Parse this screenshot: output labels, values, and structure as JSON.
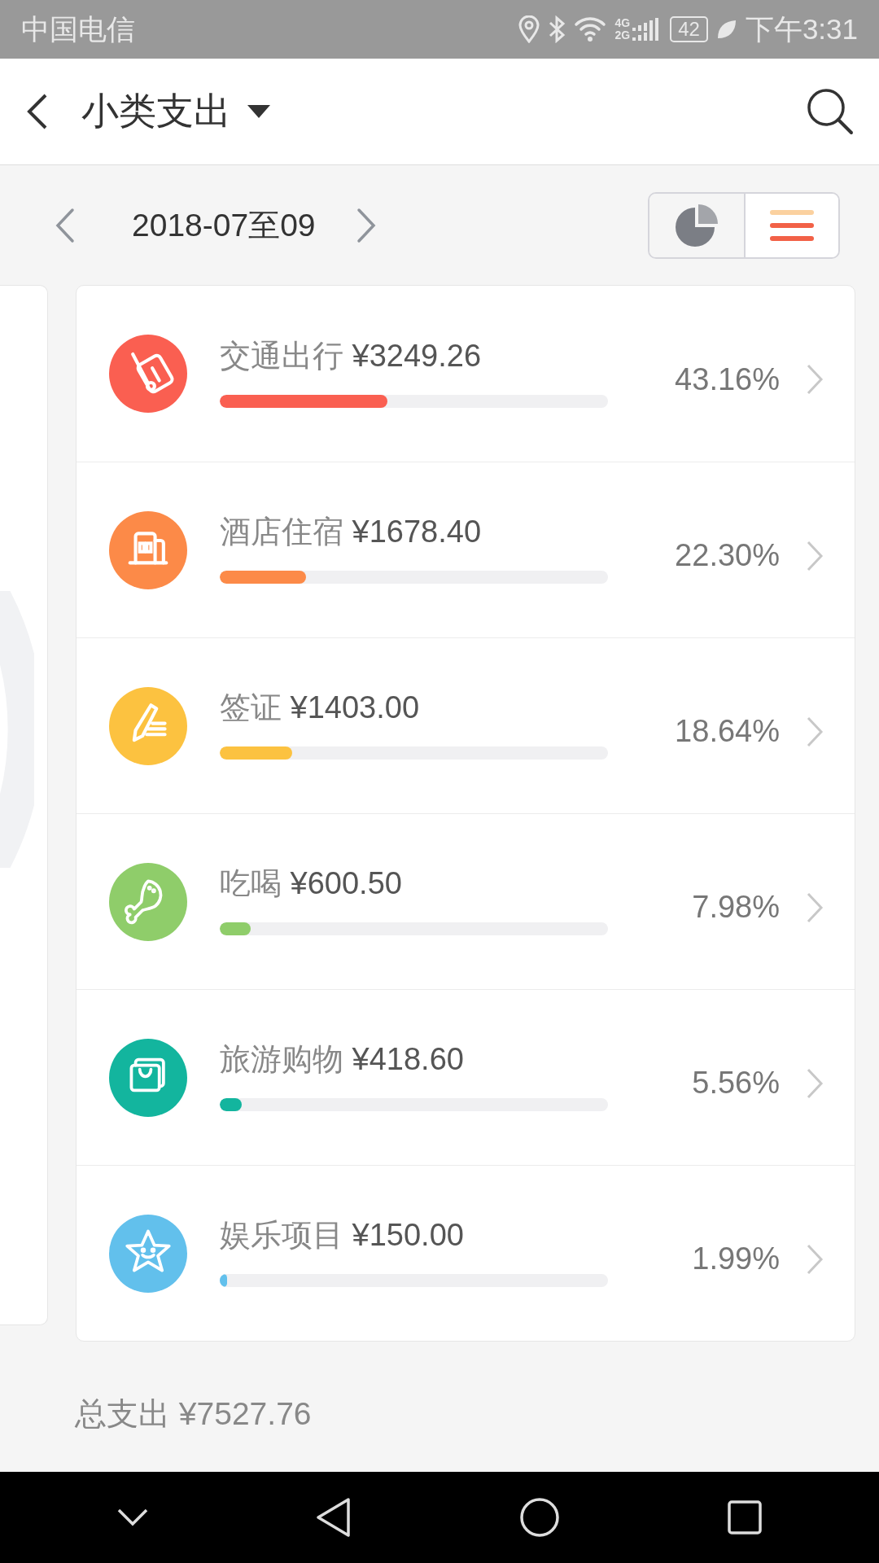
{
  "status_bar": {
    "carrier": "中国电信",
    "network": [
      "4G",
      "2G"
    ],
    "battery": "42",
    "time": "下午3:31"
  },
  "header": {
    "title": "小类支出"
  },
  "period": {
    "label": "2018-07至09"
  },
  "views": [
    {
      "kind": "pie",
      "selected": false
    },
    {
      "kind": "list",
      "selected": true
    }
  ],
  "categories": [
    {
      "kind": "transport",
      "name": "交通出行",
      "amount": "¥3249.26",
      "percent": "43.16%",
      "level": 0.4316,
      "color": "#fa5f51"
    },
    {
      "kind": "hotel",
      "name": "酒店住宿",
      "amount": "¥1678.40",
      "percent": "22.30%",
      "level": 0.223,
      "color": "#fc8a48"
    },
    {
      "kind": "visa",
      "name": "签证",
      "amount": "¥1403.00",
      "percent": "18.64%",
      "level": 0.1864,
      "color": "#fcc240"
    },
    {
      "kind": "food",
      "name": "吃喝",
      "amount": "¥600.50",
      "percent": "7.98%",
      "level": 0.0798,
      "color": "#8fcd6a"
    },
    {
      "kind": "shopping",
      "name": "旅游购物",
      "amount": "¥418.60",
      "percent": "5.56%",
      "level": 0.0556,
      "color": "#13b59e"
    },
    {
      "kind": "entertainment",
      "name": "娱乐项目",
      "amount": "¥150.00",
      "percent": "1.99%",
      "level": 0.0199,
      "color": "#62c0ec"
    }
  ],
  "total": {
    "label": "总支出",
    "amount": "¥7527.76"
  }
}
